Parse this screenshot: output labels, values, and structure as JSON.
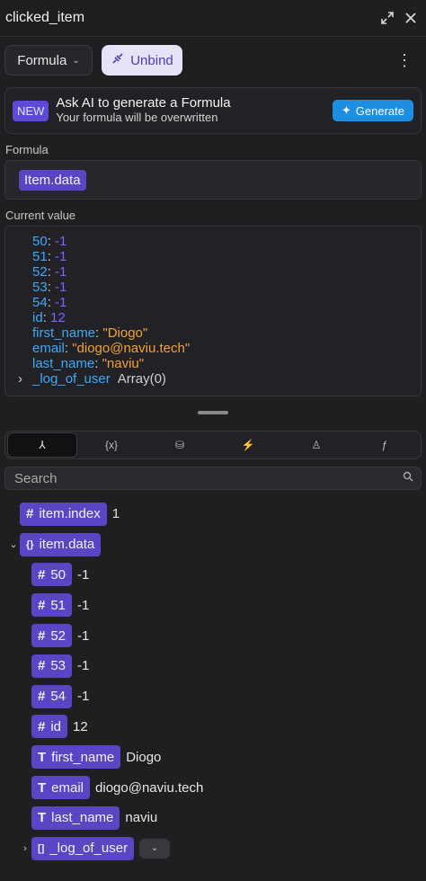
{
  "header": {
    "title": "clicked_item",
    "expand_icon": "expand-icon",
    "close_icon": "close-icon"
  },
  "toolbar": {
    "mode_label": "Formula",
    "unbind_label": "Unbind",
    "more_icon": "vertical-ellipsis-icon"
  },
  "ai_card": {
    "badge": "NEW",
    "title": "Ask AI to generate a Formula",
    "subtitle": "Your formula will be overwritten",
    "button_label": "Generate"
  },
  "formula": {
    "label": "Formula",
    "token": "Item.data"
  },
  "current_value": {
    "label": "Current value",
    "lines": [
      {
        "key": "50",
        "value": "-1",
        "type": "num"
      },
      {
        "key": "51",
        "value": "-1",
        "type": "num"
      },
      {
        "key": "52",
        "value": "-1",
        "type": "num"
      },
      {
        "key": "53",
        "value": "-1",
        "type": "num"
      },
      {
        "key": "54",
        "value": "-1",
        "type": "num"
      },
      {
        "key": "id",
        "value": "12",
        "type": "num"
      },
      {
        "key": "first_name",
        "value": "\"Diogo\"",
        "type": "str"
      },
      {
        "key": "email",
        "value": "\"diogo@naviu.tech\"",
        "type": "str"
      },
      {
        "key": "last_name",
        "value": "\"naviu\"",
        "type": "str"
      }
    ],
    "collapsed": {
      "key": "_log_of_user",
      "value": "Array(0)"
    }
  },
  "tabs": [
    {
      "icon": "fork-icon",
      "glyph": "⅄",
      "active": true
    },
    {
      "icon": "variable-icon",
      "glyph": "{x}",
      "active": false
    },
    {
      "icon": "database-icon",
      "glyph": "⛁",
      "active": false
    },
    {
      "icon": "lightning-icon",
      "glyph": "⚡",
      "active": false
    },
    {
      "icon": "user-icon",
      "glyph": "♙",
      "active": false
    },
    {
      "icon": "function-icon",
      "glyph": "ƒ",
      "active": false
    }
  ],
  "search": {
    "placeholder": "Search"
  },
  "tree": [
    {
      "indent": 0,
      "chevron": "",
      "type_icon": "#",
      "name": "item.index",
      "value": "1"
    },
    {
      "indent": 0,
      "chevron": "⌄",
      "type_icon": "{}",
      "name": "item.data",
      "value": ""
    },
    {
      "indent": 1,
      "chevron": "",
      "type_icon": "#",
      "name": "50",
      "value": "-1"
    },
    {
      "indent": 1,
      "chevron": "",
      "type_icon": "#",
      "name": "51",
      "value": "-1"
    },
    {
      "indent": 1,
      "chevron": "",
      "type_icon": "#",
      "name": "52",
      "value": "-1"
    },
    {
      "indent": 1,
      "chevron": "",
      "type_icon": "#",
      "name": "53",
      "value": "-1"
    },
    {
      "indent": 1,
      "chevron": "",
      "type_icon": "#",
      "name": "54",
      "value": "-1"
    },
    {
      "indent": 1,
      "chevron": "",
      "type_icon": "#",
      "name": "id",
      "value": "12"
    },
    {
      "indent": 1,
      "chevron": "",
      "type_icon": "T",
      "name": "first_name",
      "value": "Diogo"
    },
    {
      "indent": 1,
      "chevron": "",
      "type_icon": "T",
      "name": "email",
      "value": "diogo@naviu.tech"
    },
    {
      "indent": 1,
      "chevron": "",
      "type_icon": "T",
      "name": "last_name",
      "value": "naviu"
    },
    {
      "indent": 1,
      "chevron": "›",
      "type_icon": "[]",
      "name": "_log_of_user",
      "value": "",
      "dropdown": true
    }
  ],
  "colors": {
    "accent": "#5a45c4",
    "key": "#3fa9f5",
    "number": "#7a63ff",
    "string": "#f0a23a",
    "generate": "#1e8ee0"
  }
}
